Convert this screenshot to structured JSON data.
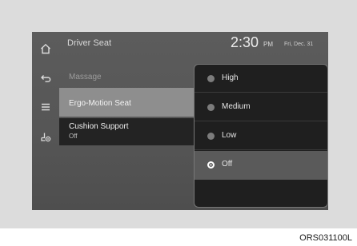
{
  "header": {
    "title": "Driver Seat",
    "time": "2:30",
    "ampm": "PM",
    "date": "Fri, Dec. 31"
  },
  "sidebar": {
    "icons": [
      "home-icon",
      "back-icon",
      "menu-icon",
      "seat-settings-icon"
    ]
  },
  "menu": {
    "items": [
      {
        "label": "Massage"
      },
      {
        "label": "Ergo-Motion Seat"
      },
      {
        "label": "Cushion Support",
        "value": "Off"
      }
    ]
  },
  "popup": {
    "options": [
      {
        "label": "High",
        "selected": false
      },
      {
        "label": "Medium",
        "selected": false
      },
      {
        "label": "Low",
        "selected": false
      },
      {
        "label": "Off",
        "selected": true
      }
    ]
  },
  "caption": "ORS031100L"
}
